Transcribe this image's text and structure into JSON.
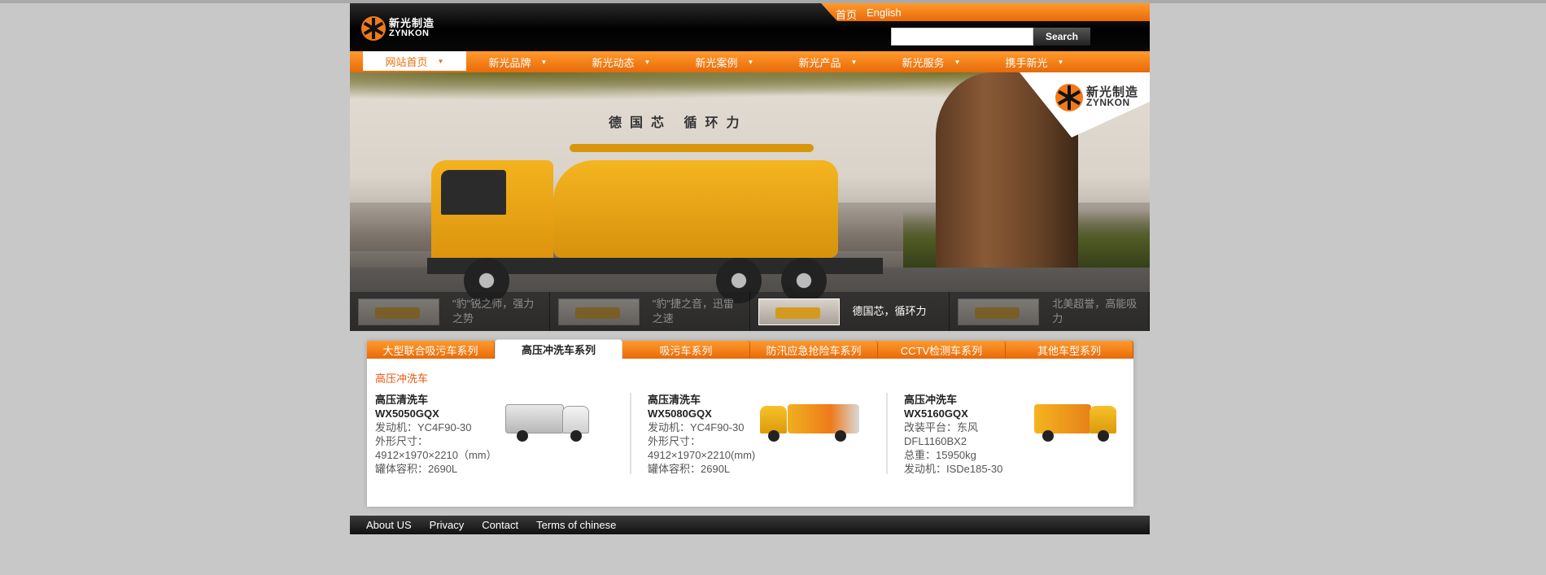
{
  "header": {
    "logo_cn": "新光制造",
    "logo_en": "ZYNKON",
    "lang_links": [
      "首页",
      "English"
    ],
    "search_placeholder": "",
    "search_button": "Search"
  },
  "nav": {
    "items": [
      {
        "label": "网站首页",
        "active": true
      },
      {
        "label": "新光品牌"
      },
      {
        "label": "新光动态"
      },
      {
        "label": "新光案例"
      },
      {
        "label": "新光产品"
      },
      {
        "label": "新光服务"
      },
      {
        "label": "携手新光"
      }
    ]
  },
  "banner": {
    "slogan": "德国芯 循环力",
    "logo_cn": "新光制造",
    "logo_en": "ZYNKON",
    "thumbs": [
      {
        "text": "\"豹\"锐之师，强力之势"
      },
      {
        "text": "\"豹\"捷之音，迅雷之速"
      },
      {
        "text": "德国芯，循环力",
        "active": true
      },
      {
        "text": "北美超誉，高能吸力"
      }
    ]
  },
  "products": {
    "tabs": [
      {
        "label": "大型联合吸污车系列"
      },
      {
        "label": "高压冲洗车系列",
        "active": true
      },
      {
        "label": "吸污车系列"
      },
      {
        "label": "防汛应急抢险车系列"
      },
      {
        "label": "CCTV检测车系列"
      },
      {
        "label": "其他车型系列"
      }
    ],
    "category_title": "高压冲洗车",
    "items": [
      {
        "name": "高压清洗车",
        "model": "WX5050GQX",
        "lines": [
          "发动机：YC4F90-30",
          "外形尺寸：",
          "4912×1970×2210（mm）",
          "罐体容积：2690L"
        ]
      },
      {
        "name": "高压清洗车",
        "model": "WX5080GQX",
        "lines": [
          "发动机：YC4F90-30",
          "外形尺寸：",
          "4912×1970×2210(mm)",
          "罐体容积：2690L"
        ]
      },
      {
        "name": "高压冲洗车",
        "model": "WX5160GQX",
        "lines": [
          "改装平台：东风",
          "DFL1160BX2",
          "总重：15950kg",
          "发动机：ISDe185-30"
        ]
      }
    ]
  },
  "footer": {
    "links": [
      "About US",
      "Privacy",
      "Contact",
      "Terms of chinese"
    ]
  },
  "colors": {
    "accent_orange": "#f07a1a",
    "header_black": "#000000",
    "category_red": "#e8560e"
  }
}
